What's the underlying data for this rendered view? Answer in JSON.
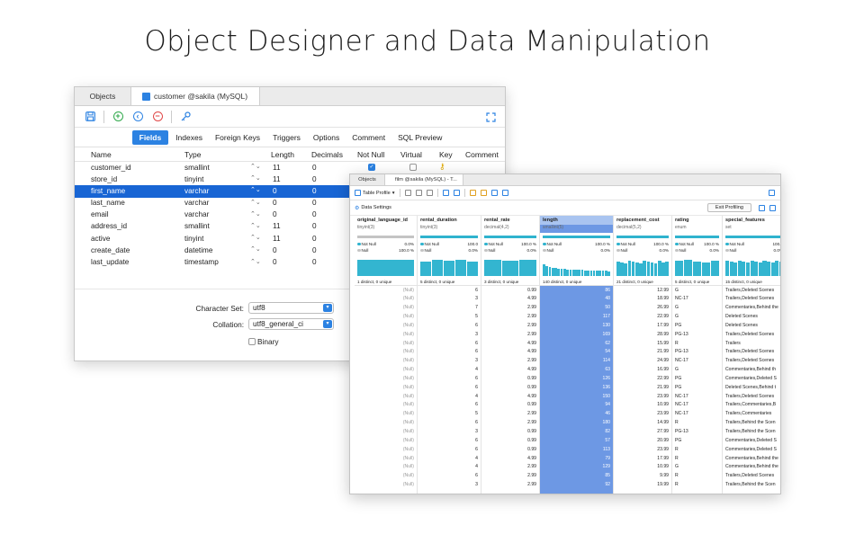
{
  "hero_title": "Object Designer and Data Manipulation",
  "designer": {
    "tabs": [
      "Objects",
      "customer @sakila (MySQL)"
    ],
    "subtabs": [
      "Fields",
      "Indexes",
      "Foreign Keys",
      "Triggers",
      "Options",
      "Comment",
      "SQL Preview"
    ],
    "active_subtab": "Fields",
    "headers": [
      "Name",
      "Type",
      "Length",
      "Decimals",
      "Not Null",
      "Virtual",
      "Key",
      "Comment"
    ],
    "rows": [
      {
        "name": "customer_id",
        "type": "smallint",
        "length": "11",
        "decimals": "0",
        "notnull": true,
        "key": true
      },
      {
        "name": "store_id",
        "type": "tinyint",
        "length": "11",
        "decimals": "0"
      },
      {
        "name": "first_name",
        "type": "varchar",
        "length": "0",
        "decimals": "0",
        "selected": true
      },
      {
        "name": "last_name",
        "type": "varchar",
        "length": "0",
        "decimals": "0"
      },
      {
        "name": "email",
        "type": "varchar",
        "length": "0",
        "decimals": "0"
      },
      {
        "name": "address_id",
        "type": "smallint",
        "length": "11",
        "decimals": "0"
      },
      {
        "name": "active",
        "type": "tinyint",
        "length": "11",
        "decimals": "0"
      },
      {
        "name": "create_date",
        "type": "datetime",
        "length": "0",
        "decimals": "0"
      },
      {
        "name": "last_update",
        "type": "timestamp",
        "length": "0",
        "decimals": "0"
      }
    ],
    "charset_label": "Character Set:",
    "charset_value": "utf8",
    "collation_label": "Collation:",
    "collation_value": "utf8_general_ci",
    "binary_label": "Binary"
  },
  "viewer": {
    "tabs": [
      "Objects",
      "film @sakila (MySQL) - T..."
    ],
    "table_profile": "Table Profile",
    "data_settings": "Data Settings",
    "exit_profiling": "Exit Profiling",
    "columns": [
      {
        "name": "original_language_id",
        "type": "tinyint(3)",
        "nn_pct": "0.0%",
        "null_pct": "100.0 %",
        "footer": "1 distinct, 0 unique",
        "align": "r",
        "gray": true
      },
      {
        "name": "rental_duration",
        "type": "tinyint(3)",
        "nn_pct": "100.0",
        "null_pct": "0.0%",
        "footer": "5 distinct, 0 unique",
        "align": "r"
      },
      {
        "name": "rental_rate",
        "type": "decimal(4,2)",
        "nn_pct": "100.0 %",
        "null_pct": "0.0%",
        "footer": "3 distinct, 0 unique",
        "align": "r"
      },
      {
        "name": "length",
        "type": "smallint(5)",
        "nn_pct": "100.0 %",
        "null_pct": "0.0%",
        "footer": "140 distinct, 0 unique",
        "align": "r",
        "highlight": true
      },
      {
        "name": "replacement_cost",
        "type": "decimal(5,2)",
        "nn_pct": "100.0 %",
        "null_pct": "0.0%",
        "footer": "21 distinct, 0 unique",
        "align": "r"
      },
      {
        "name": "rating",
        "type": "enum",
        "nn_pct": "100.0 %",
        "null_pct": "0.0%",
        "footer": "5 distinct, 0 unique",
        "align": "l"
      },
      {
        "name": "special_features",
        "type": "set",
        "nn_pct": "100.0",
        "null_pct": "0.0%",
        "footer": "15 distinct, 0 unique",
        "align": "l"
      }
    ],
    "not_null_label": "Not Null",
    "null_label": "Null",
    "rows": [
      [
        "(Null)",
        "6",
        "0.99",
        "86",
        "12.99",
        "G",
        "Trailers,Deleted Scenes"
      ],
      [
        "(Null)",
        "3",
        "4.99",
        "48",
        "18.99",
        "NC-17",
        "Trailers,Deleted Scenes"
      ],
      [
        "(Null)",
        "7",
        "2.99",
        "50",
        "26.99",
        "G",
        "Commentaries,Behind the"
      ],
      [
        "(Null)",
        "5",
        "2.99",
        "117",
        "22.99",
        "G",
        "Deleted Scenes"
      ],
      [
        "(Null)",
        "6",
        "2.99",
        "130",
        "17.99",
        "PG",
        "Deleted Scenes"
      ],
      [
        "(Null)",
        "3",
        "2.99",
        "169",
        "28.99",
        "PG-13",
        "Trailers,Deleted Scenes"
      ],
      [
        "(Null)",
        "6",
        "4.99",
        "62",
        "15.99",
        "R",
        "Trailers"
      ],
      [
        "(Null)",
        "6",
        "4.99",
        "54",
        "21.99",
        "PG-13",
        "Trailers,Deleted Scenes"
      ],
      [
        "(Null)",
        "3",
        "2.99",
        "114",
        "24.99",
        "NC-17",
        "Trailers,Deleted Scenes"
      ],
      [
        "(Null)",
        "4",
        "4.99",
        "63",
        "16.99",
        "G",
        "Commentaries,Behind th"
      ],
      [
        "(Null)",
        "6",
        "0.99",
        "126",
        "22.99",
        "PG",
        "Commentaries,Deleted S"
      ],
      [
        "(Null)",
        "6",
        "0.99",
        "136",
        "21.99",
        "PG",
        "Deleted Scenes,Behind t"
      ],
      [
        "(Null)",
        "4",
        "4.99",
        "150",
        "23.99",
        "NC-17",
        "Trailers,Deleted Scenes"
      ],
      [
        "(Null)",
        "6",
        "0.99",
        "94",
        "10.99",
        "NC-17",
        "Trailers,Commentaries,B"
      ],
      [
        "(Null)",
        "5",
        "2.99",
        "46",
        "23.99",
        "NC-17",
        "Trailers,Commentaries"
      ],
      [
        "(Null)",
        "6",
        "2.99",
        "180",
        "14.99",
        "R",
        "Trailers,Behind the Scen"
      ],
      [
        "(Null)",
        "3",
        "0.99",
        "82",
        "27.99",
        "PG-13",
        "Trailers,Behind the Scen"
      ],
      [
        "(Null)",
        "6",
        "0.99",
        "57",
        "20.99",
        "PG",
        "Commentaries,Deleted S"
      ],
      [
        "(Null)",
        "6",
        "0.99",
        "113",
        "23.99",
        "R",
        "Commentaries,Deleted S"
      ],
      [
        "(Null)",
        "4",
        "4.99",
        "79",
        "17.99",
        "R",
        "Commentaries,Behind the"
      ],
      [
        "(Null)",
        "4",
        "2.99",
        "129",
        "10.99",
        "G",
        "Commentaries,Behind the"
      ],
      [
        "(Null)",
        "6",
        "2.99",
        "85",
        "9.99",
        "R",
        "Trailers,Deleted Scenes"
      ],
      [
        "(Null)",
        "3",
        "2.99",
        "92",
        "19.99",
        "R",
        "Trailers,Behind the Scen"
      ]
    ]
  }
}
